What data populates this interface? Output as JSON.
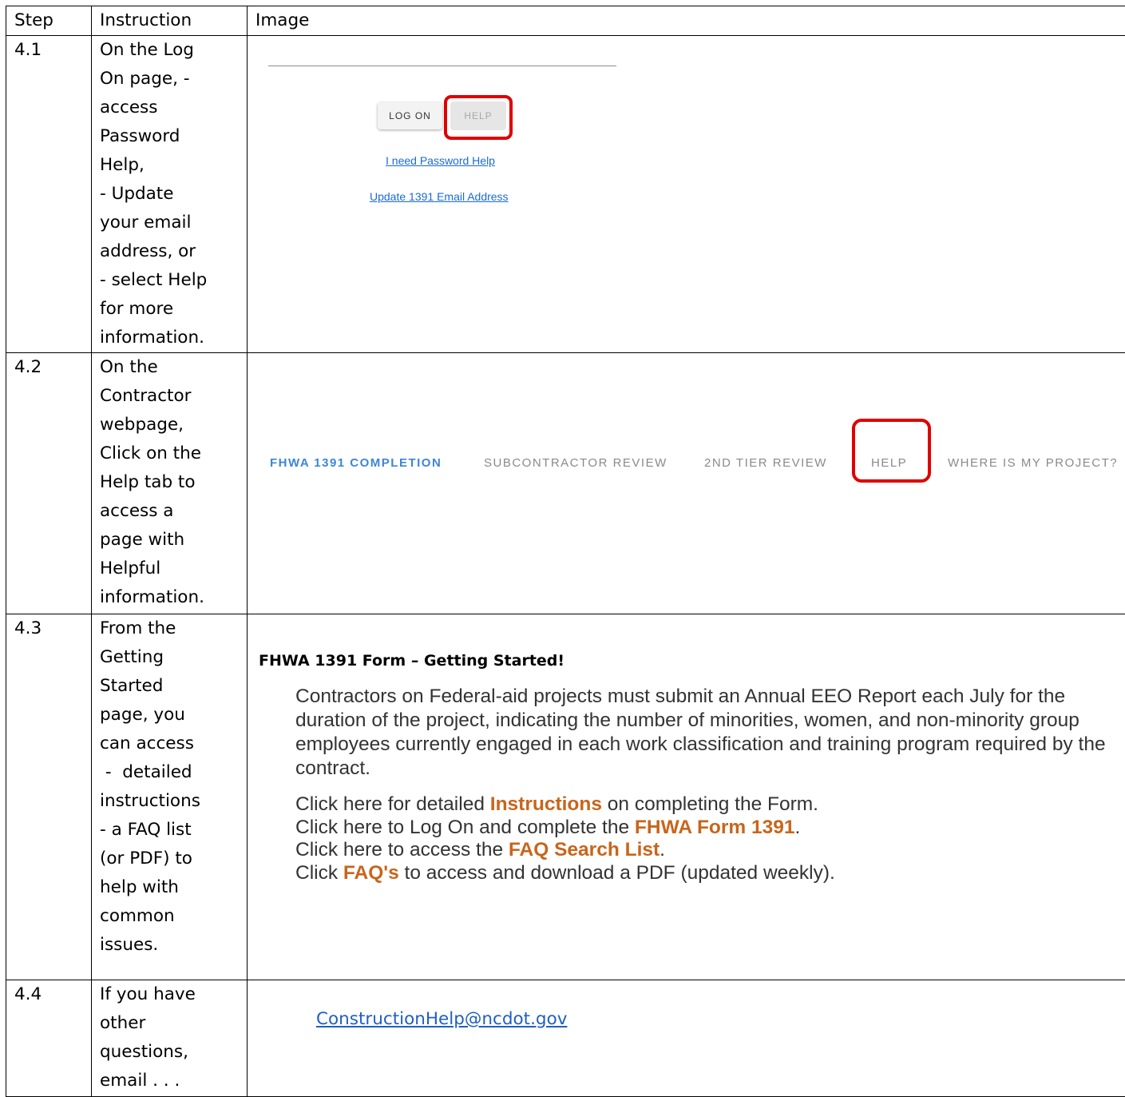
{
  "header": {
    "step": "Step",
    "instruction": "Instruction",
    "image": "Image"
  },
  "rows": [
    {
      "step": "4.1",
      "instruction_lines": [
        "On the Log",
        "On page, -",
        "access",
        "Password",
        "Help,",
        "- Update",
        "your email",
        "address, or",
        "- select Help",
        "for more",
        "information."
      ]
    },
    {
      "step": "4.2",
      "instruction_lines": [
        "On the",
        "Contractor",
        "webpage,",
        "Click on the",
        "Help tab to",
        "access a",
        "page with",
        "Helpful",
        "information."
      ]
    },
    {
      "step": "4.3",
      "instruction_lines": [
        "From the",
        "Getting",
        "Started",
        "page, you",
        "can access",
        " -  detailed",
        "instructions",
        "- a FAQ list",
        "(or PDF) to",
        "help with",
        "common",
        "issues."
      ]
    },
    {
      "step": "4.4",
      "instruction_lines": [
        "If you have",
        "other",
        "questions,",
        "email . . ."
      ]
    }
  ],
  "login": {
    "logon_button": "LOG ON",
    "help_button": "HELP",
    "password_link": "I need Password Help",
    "update_email_link": "Update 1391 Email Address"
  },
  "nav": {
    "items": [
      "FHWA 1391 COMPLETION",
      "SUBCONTRACTOR REVIEW",
      "2ND TIER REVIEW",
      "HELP",
      "WHERE IS MY PROJECT?"
    ],
    "active_color": "#3d86d6",
    "inactive_color": "#8a8a8a"
  },
  "getting_started": {
    "title": "FHWA 1391 Form – Getting Started!",
    "paragraph": "Contractors on Federal-aid projects must submit an Annual EEO Report each July for the duration of the project, indicating the number of minorities, women, and non-minority group employees currently engaged in each work classification and training program required by the contract.",
    "lines": [
      {
        "pre": "Click here for detailed ",
        "link": "Instructions",
        "post": " on completing the Form."
      },
      {
        "pre": "Click here to Log On and complete the ",
        "link": "FHWA Form 1391",
        "post": "."
      },
      {
        "pre": "Click here to access the ",
        "link": "FAQ Search List",
        "post": "."
      },
      {
        "pre": "Click ",
        "link": "FAQ's",
        "post": " to access and download a PDF (updated weekly)."
      }
    ],
    "link_color": "#c8651b"
  },
  "contact": {
    "email": "ConstructionHelp@ncdot.gov"
  },
  "highlight_color": "#e00000"
}
